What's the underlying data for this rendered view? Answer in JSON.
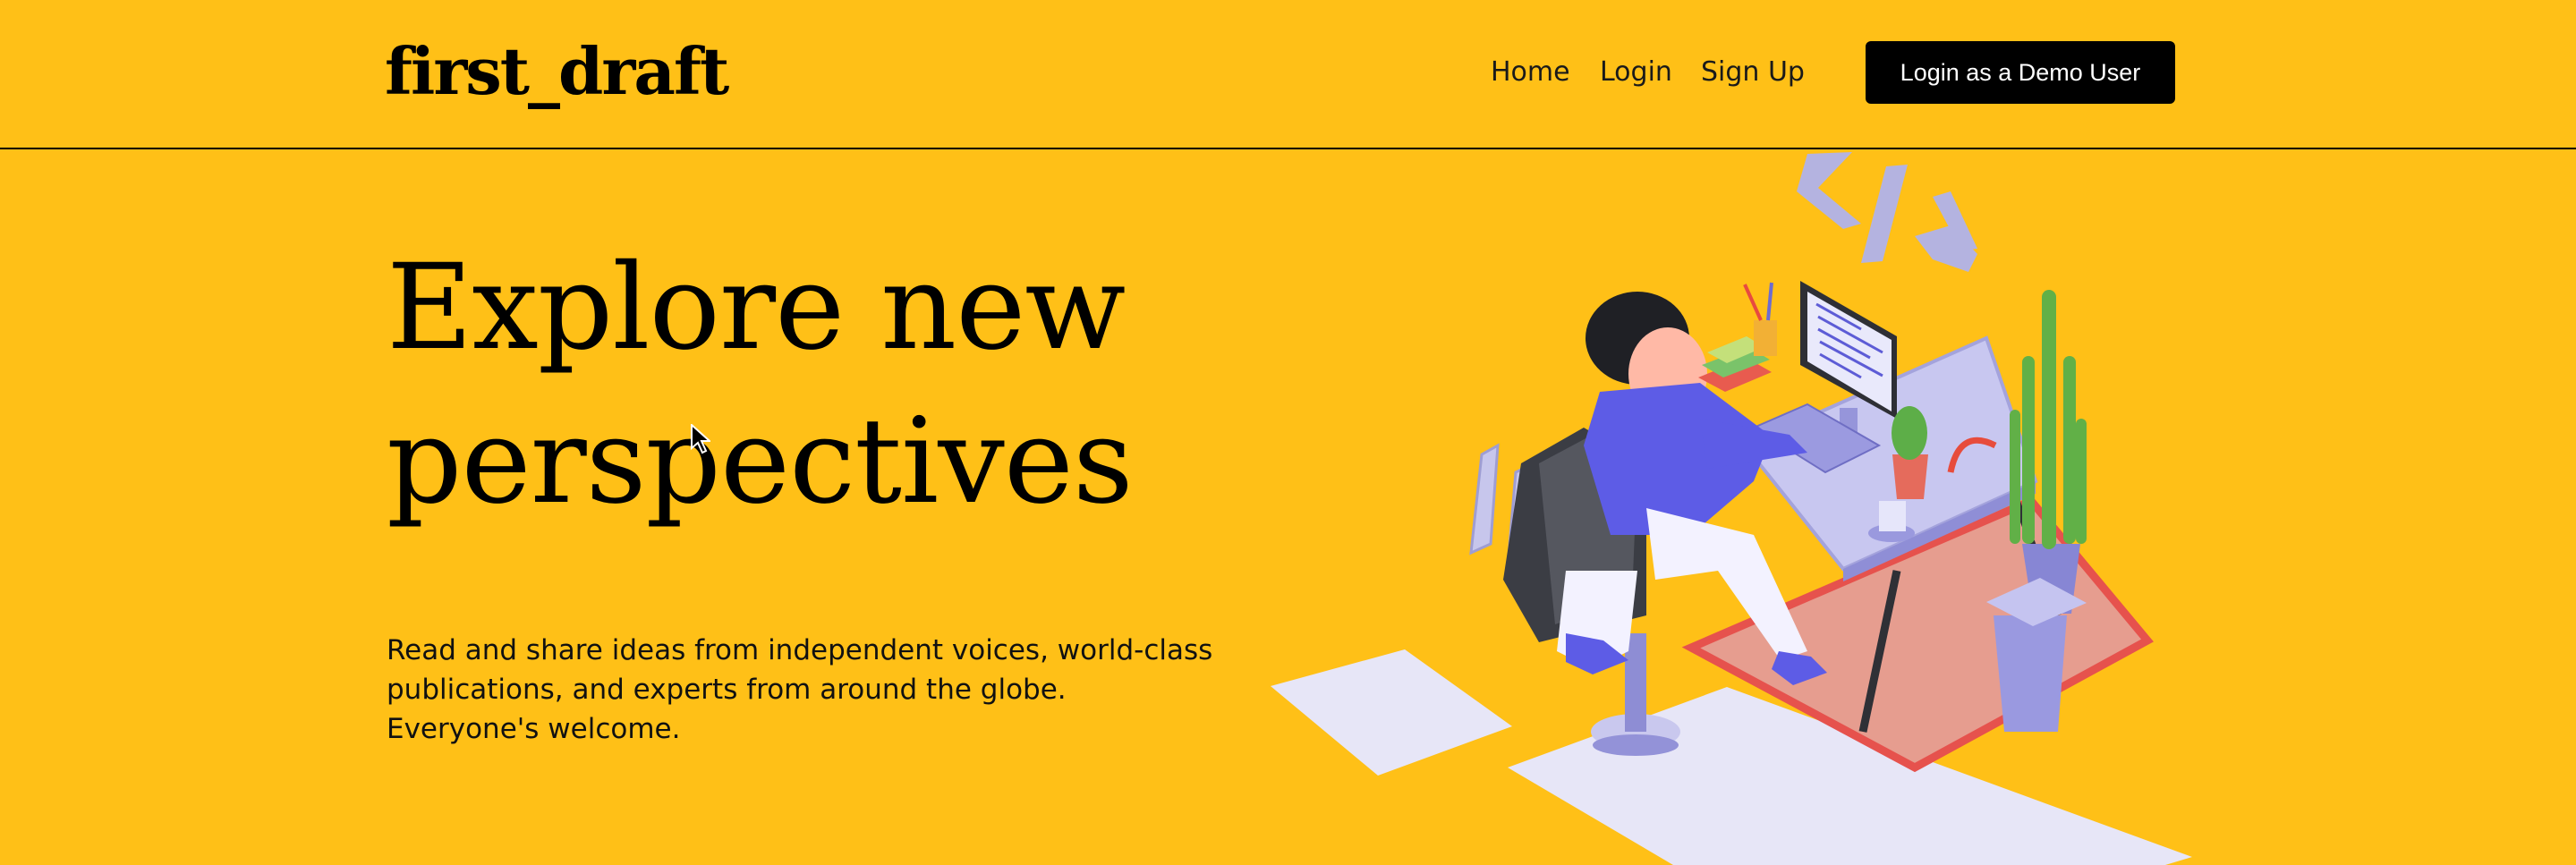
{
  "header": {
    "logo": "first_draft",
    "nav": [
      {
        "label": "Home"
      },
      {
        "label": "Login"
      },
      {
        "label": "Sign Up"
      }
    ],
    "demo_button": "Login as a Demo User"
  },
  "hero": {
    "title_line1": "Explore new",
    "title_line2": "perspectives",
    "text": "Read and share ideas from independent voices, world-class publications, and experts from around the globe. Everyone's welcome."
  },
  "colors": {
    "background": "#FFC017",
    "button": "#000000",
    "button_text": "#FFFFFF"
  },
  "illustration": {
    "icon": "developer-at-desk-illustration"
  }
}
